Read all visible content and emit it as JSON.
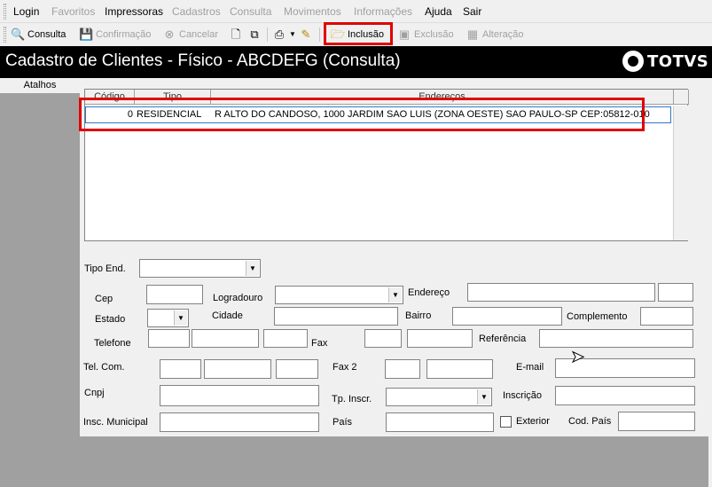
{
  "menu": [
    {
      "label": "Login",
      "enabled": true
    },
    {
      "label": "Favoritos",
      "enabled": false
    },
    {
      "label": "Impressoras",
      "enabled": true
    },
    {
      "label": "Cadastros",
      "enabled": false
    },
    {
      "label": "Consulta",
      "enabled": false
    },
    {
      "label": "Movimentos",
      "enabled": false
    },
    {
      "label": "Informações",
      "enabled": false
    },
    {
      "label": "Ajuda",
      "enabled": true
    },
    {
      "label": "Sair",
      "enabled": true
    }
  ],
  "toolbar": {
    "consulta": "Consulta",
    "confirmacao": "Confirmação",
    "cancelar": "Cancelar",
    "inclusao": "Inclusão",
    "exclusao": "Exclusão",
    "alteracao": "Alteração"
  },
  "title": "Cadastro de Clientes - Físico  - ABCDEFG (Consulta)",
  "logo_text": "TOTVS",
  "left_panel": {
    "header": "Atalhos"
  },
  "grid": {
    "headers": {
      "codigo": "Código",
      "tipo": "Tipo",
      "enderecos": "Endereços"
    },
    "rows": [
      {
        "codigo": "0",
        "tipo": "RESIDENCIAL",
        "endereco": "R  ALTO DO CANDOSO, 1000 JARDIM SAO LUIS (ZONA OESTE) SAO PAULO-SP CEP:05812-010"
      }
    ]
  },
  "form": {
    "tipo_end": "Tipo End.",
    "cep": "Cep",
    "logradouro": "Logradouro",
    "endereco": "Endereço",
    "estado": "Estado",
    "cidade": "Cidade",
    "bairro": "Bairro",
    "complemento": "Complemento",
    "telefone": "Telefone",
    "fax": "Fax",
    "referencia": "Referência",
    "tel_com": "Tel. Com.",
    "fax2": "Fax 2",
    "email": "E-mail",
    "cnpj": "Cnpj",
    "tp_inscr": "Tp. Inscr.",
    "inscricao": "Inscrição",
    "insc_municipal": "Insc. Municipal",
    "pais": "País",
    "exterior": "Exterior",
    "cod_pais": "Cod. País"
  },
  "colors": {
    "highlight": "#e00000",
    "titlebar": "#000000",
    "panel": "#a0a0a0"
  }
}
